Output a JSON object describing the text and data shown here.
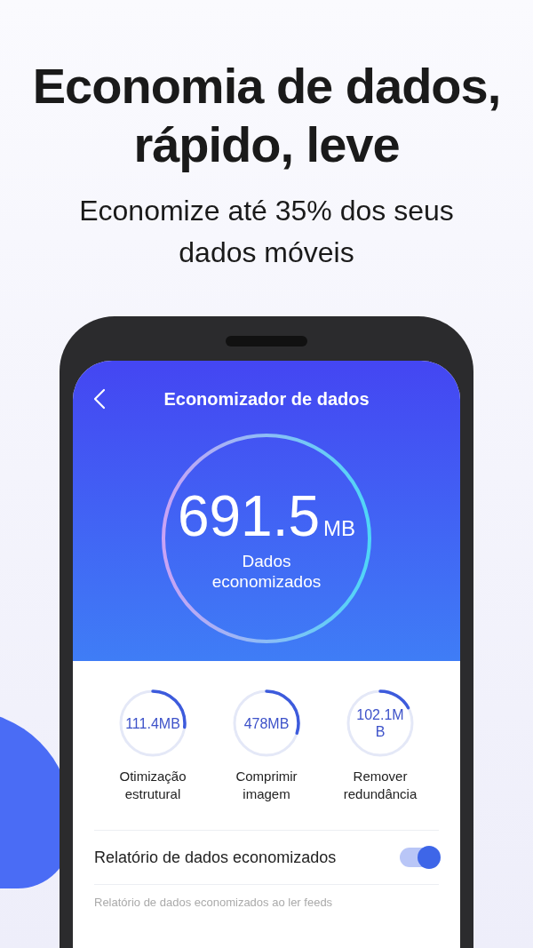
{
  "headline": "Economia de dados, rápido, leve",
  "subtitle": "Economize até 35% dos seus dados móveis",
  "screen": {
    "title": "Economizador de dados",
    "summary": {
      "value": "691.5",
      "unit": "MB",
      "label": "Dados economizados"
    },
    "stats": [
      {
        "value": "111.4MB",
        "label": "Otimização estrutural",
        "level": 0.27
      },
      {
        "value": "478MB",
        "label": "Comprimir imagem",
        "level": 0.3
      },
      {
        "value": "102.1MB",
        "label": "Remover redundância",
        "level": 0.17
      }
    ],
    "setting": {
      "label": "Relatório de dados economizados",
      "on": true,
      "description": "Relatório de dados economizados ao ler feeds"
    }
  }
}
